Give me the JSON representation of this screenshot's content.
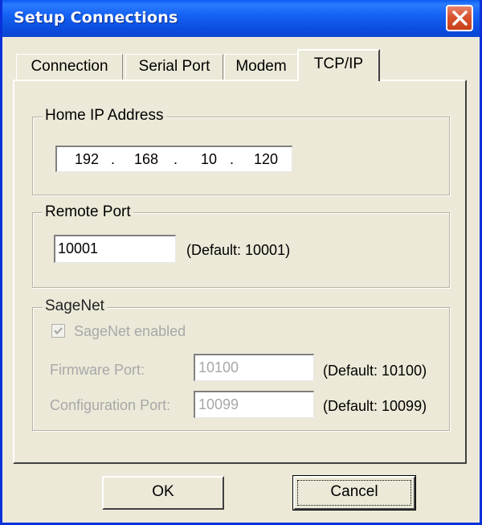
{
  "window": {
    "title": "Setup Connections"
  },
  "tabs": [
    {
      "label": "Connection",
      "active": false
    },
    {
      "label": "Serial Port",
      "active": false
    },
    {
      "label": "Modem",
      "active": false
    },
    {
      "label": "TCP/IP",
      "active": true
    }
  ],
  "home_ip": {
    "legend": "Home IP Address",
    "octets": [
      "192",
      "168",
      "10",
      "120"
    ],
    "separator": "."
  },
  "remote_port": {
    "legend": "Remote Port",
    "value": "10001",
    "default_note": "(Default: 10001)"
  },
  "sagenet": {
    "legend": "SageNet",
    "enabled_label": "SageNet enabled",
    "enabled_checked": true,
    "firmware_port_label": "Firmware Port:",
    "firmware_port_value": "10100",
    "firmware_default_note": "(Default: 10100)",
    "config_port_label": "Configuration Port:",
    "config_port_value": "10099",
    "config_default_note": "(Default: 10099)"
  },
  "buttons": {
    "ok": "OK",
    "cancel": "Cancel"
  },
  "colors": {
    "titlebar": "#0A5BF0",
    "dialog_bg": "#ECE9D8",
    "close_button": "#D9542E",
    "disabled_text": "#A8A8A8"
  },
  "icons": {
    "close": "close-icon",
    "check": "checkmark-icon"
  }
}
